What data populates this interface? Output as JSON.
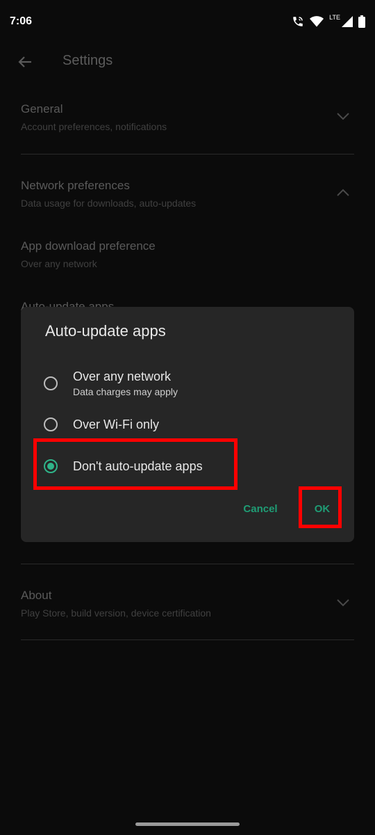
{
  "status_bar": {
    "time": "7:06",
    "network_label": "LTE"
  },
  "app_bar": {
    "title": "Settings"
  },
  "settings": {
    "general": {
      "title": "General",
      "subtitle": "Account preferences, notifications"
    },
    "network": {
      "title": "Network preferences",
      "subtitle": "Data usage for downloads, auto-updates"
    },
    "app_download": {
      "title": "App download preference",
      "subtitle": "Over any network"
    },
    "auto_update": {
      "title": "Auto-update apps"
    },
    "about": {
      "title": "About",
      "subtitle": "Play Store, build version, device certification"
    }
  },
  "dialog": {
    "title": "Auto-update apps",
    "options": [
      {
        "label": "Over any network",
        "subtitle": "Data charges may apply",
        "selected": false
      },
      {
        "label": "Over Wi-Fi only",
        "selected": false
      },
      {
        "label": "Don't auto-update apps",
        "selected": true
      }
    ],
    "cancel_label": "Cancel",
    "ok_label": "OK"
  },
  "colors": {
    "accent": "#2fb489",
    "button_text": "#1f9d75",
    "highlight": "#ff0000",
    "dialog_bg": "#262626",
    "background": "#0b0b0b"
  }
}
